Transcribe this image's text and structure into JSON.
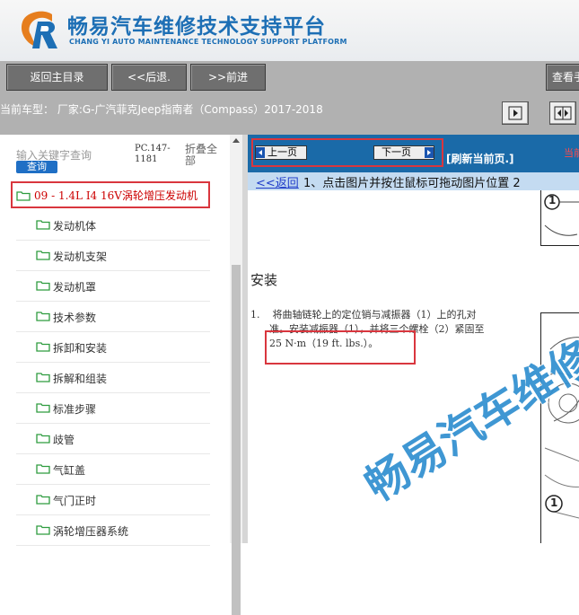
{
  "brand": {
    "title_cn": "畅易汽车维修技术支持平台",
    "title_en": "CHANG YI AUTO MAINTENANCE TECHNOLOGY SUPPORT PLATFORM",
    "logo": "cy-logo-icon",
    "color": "#1d6fb5"
  },
  "nav": {
    "home": "返回主目录",
    "back": "<<后退.",
    "forward": ">>前进",
    "view": "查看手"
  },
  "vehicle": {
    "text": "当前车型：  厂家:G-广汽菲克Jeep指南者（Compass）2017-2018"
  },
  "left": {
    "search_placeholder": "输入关键字查询",
    "search_button": "查询",
    "pc_code": "PC.147-\n1181",
    "collapse_all": "折叠全\n部",
    "root": "09 - 1.4L I4 16V涡轮增压发动机",
    "items": [
      {
        "label": "发动机体"
      },
      {
        "label": "发动机支架"
      },
      {
        "label": "发动机罩"
      },
      {
        "label": "技术参数"
      },
      {
        "label": "拆卸和安装"
      },
      {
        "label": "拆解和组装"
      },
      {
        "label": "标准步骤"
      },
      {
        "label": "歧管"
      },
      {
        "label": "气缸盖"
      },
      {
        "label": "气门正时"
      },
      {
        "label": "涡轮增压器系统"
      }
    ]
  },
  "right": {
    "prev_page": "上一页",
    "next_page": "下一页",
    "refresh": "[刷新当前页.]",
    "current": "当前",
    "back_link": "<<返回",
    "instruction": "1、点击图片并按住鼠标可拖动图片位置 2",
    "doc_heading": "安装",
    "doc_step": "1.    将曲轴链轮上的定位销与减振器（1）上的孔对\n      准。安装减振器（1），并将三个螺栓（2）紧固至\n      25 N·m（19 ft. lbs.）。",
    "watermark": "畅易汽车维修",
    "callout_1": "1",
    "callout_2": "1"
  },
  "colors": {
    "toolbar_blue": "#1a6aa8",
    "highlight_red": "#d9363e",
    "folder_green": "#2e9c3f",
    "nav_gray": "#b1b1b1"
  }
}
